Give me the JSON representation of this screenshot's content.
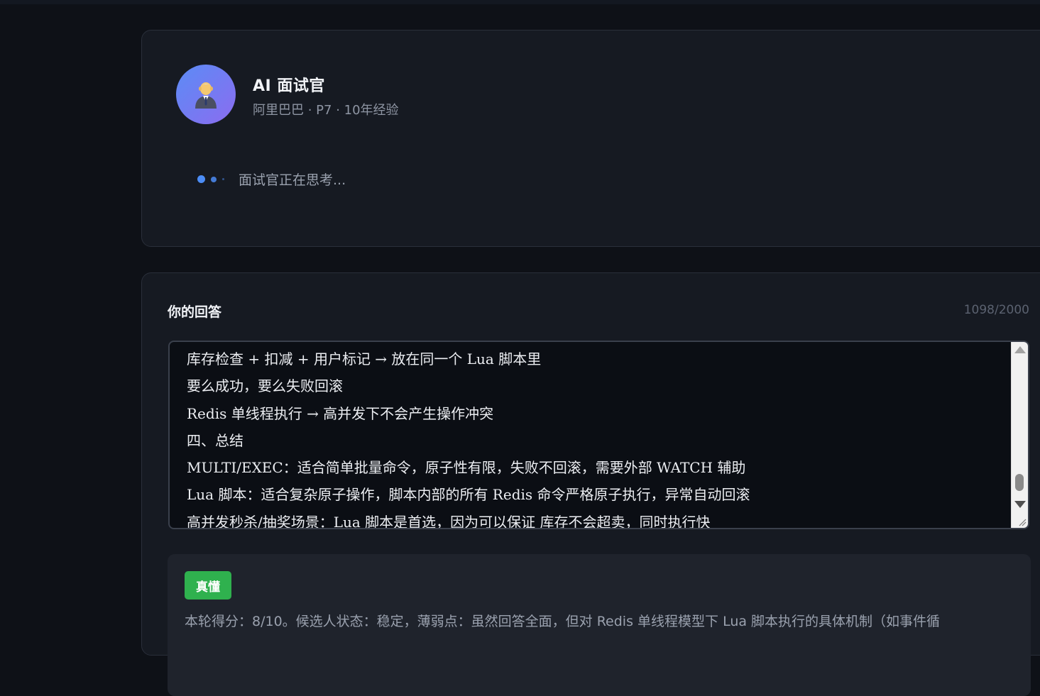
{
  "interviewer": {
    "avatar_icon": "old-man-in-suit-icon",
    "name": "AI 面试官",
    "meta": "阿里巴巴 · P7 · 10年经验",
    "thinking_text": "面试官正在思考..."
  },
  "answer": {
    "title": "你的回答",
    "char_count": "1098/2000",
    "lines": [
      "库存检查 + 扣减 + 用户标记 → 放在同一个 Lua 脚本里",
      "要么成功，要么失败回滚",
      "Redis 单线程执行 → 高并发下不会产生操作冲突",
      "四、总结",
      "MULTI/EXEC：适合简单批量命令，原子性有限，失败不回滚，需要外部 WATCH 辅助",
      "Lua 脚本：适合复杂原子操作，脚本内部的所有 Redis 命令严格原子执行，异常自动回滚",
      "高并发秒杀/抽奖场景：Lua 脚本是首选，因为可以保证 库存不会超卖，同时执行快"
    ]
  },
  "evaluation": {
    "badge": "真懂",
    "badge_color": "#2fb14e",
    "text": "本轮得分：8/10。候选人状态：稳定，薄弱点：虽然回答全面，但对 Redis 单线程模型下 Lua 脚本执行的具体机制（如事件循"
  },
  "colors": {
    "background": "#0e1117",
    "card": "#161a22",
    "accent": "#4c8df6"
  }
}
